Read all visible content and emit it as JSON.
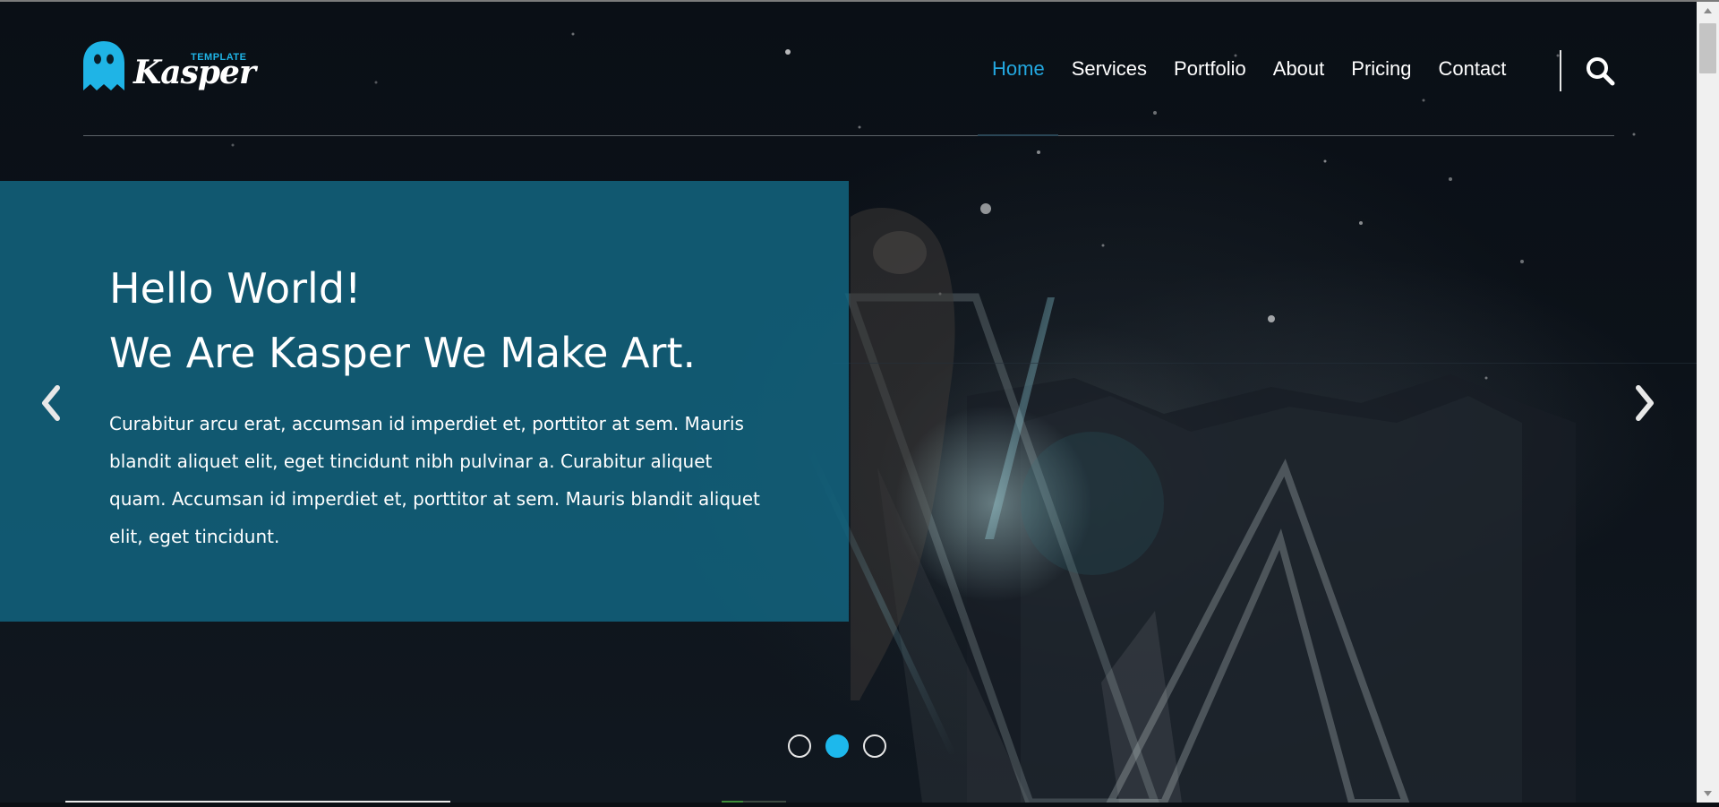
{
  "brand": {
    "name": "Kasper",
    "tagline": "TEMPLATE",
    "accent_color": "#1fb4e6",
    "logo_icon": "ghost-icon"
  },
  "nav": {
    "items": [
      {
        "label": "Home",
        "active": true
      },
      {
        "label": "Services",
        "active": false
      },
      {
        "label": "Portfolio",
        "active": false
      },
      {
        "label": "About",
        "active": false
      },
      {
        "label": "Pricing",
        "active": false
      },
      {
        "label": "Contact",
        "active": false
      }
    ],
    "active_color": "#23a8e0",
    "search_icon": "search-icon"
  },
  "slider": {
    "title_line1": "Hello World!",
    "title_line2": "We Are Kasper We Make Art.",
    "text": "Curabitur arcu erat, accumsan id imperdiet et, porttitor at sem. Mauris blandit aliquet elit, eget tincidunt nibh pulvinar a. Curabitur aliquet quam. Accumsan id imperdiet et, porttitor at sem. Mauris blandit aliquet elit, eget tincidunt.",
    "box_color": "#126884",
    "prev_icon": "chevron-left-icon",
    "next_icon": "chevron-right-icon",
    "slides_total": 3,
    "active_slide": 2,
    "dot_active_color": "#1db8ec"
  }
}
